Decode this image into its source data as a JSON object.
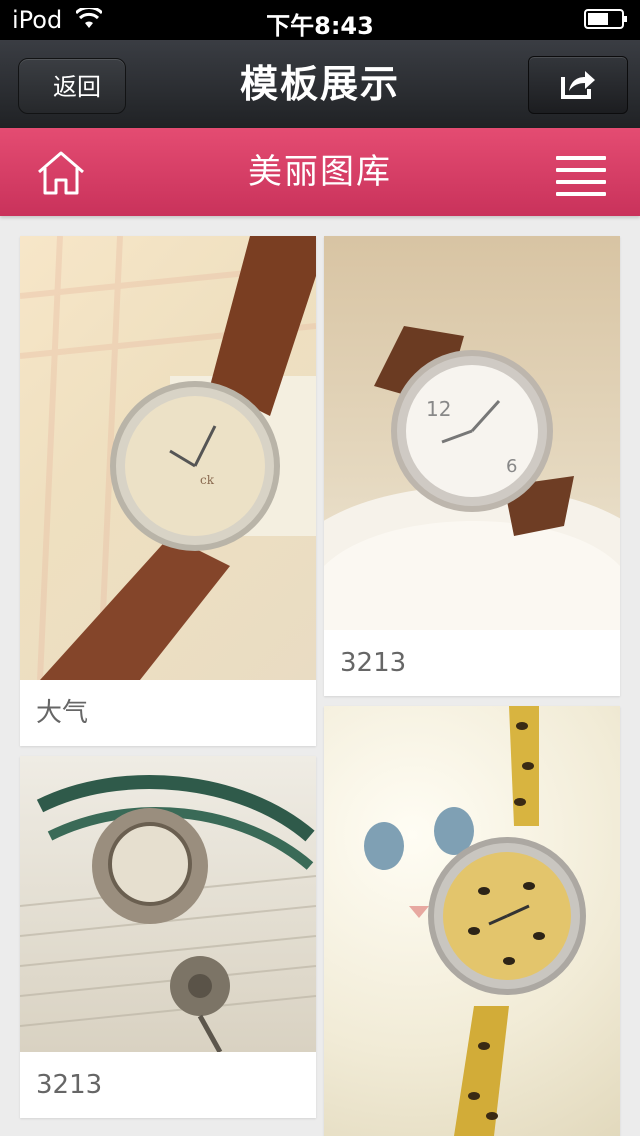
{
  "status_bar": {
    "carrier": "iPod",
    "time": "下午8:43"
  },
  "nav": {
    "back_label": "返回",
    "title": "模板展示"
  },
  "header": {
    "title": "美丽图库"
  },
  "gallery": [
    {
      "caption": "大气",
      "photo_icon": "watch-brown-leather-photo"
    },
    {
      "caption": "3213",
      "photo_icon": "watch-white-dial-photo"
    },
    {
      "caption": "3213",
      "photo_icon": "vintage-flower-watch-photo"
    },
    {
      "caption": "",
      "photo_icon": "leopard-watch-cat-photo"
    }
  ],
  "colors": {
    "accent": "#d83a64",
    "nav_bg": "#2a2c30",
    "page_bg": "#ececec"
  }
}
